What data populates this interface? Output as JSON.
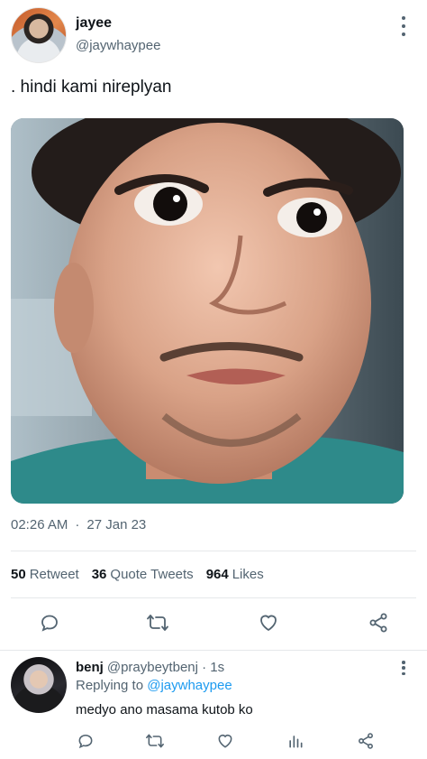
{
  "tweet": {
    "display_name": "jayee",
    "handle": "@jaywhaypee",
    "text": ". hindi kami nireplyan",
    "time": "02:26 AM",
    "separator": "·",
    "date": "27 Jan 23",
    "stats": {
      "retweets_count": "50",
      "retweets_label": "Retweet",
      "quotes_count": "36",
      "quotes_label": "Quote Tweets",
      "likes_count": "964",
      "likes_label": "Likes"
    }
  },
  "reply": {
    "display_name": "benj",
    "handle_time": "@praybeytbenj · 1s",
    "replying_prefix": "Replying to",
    "replying_to": "@jaywhaypee",
    "text": "medyo ano masama kutob ko"
  },
  "icons": {
    "reply": "reply-icon",
    "retweet": "retweet-icon",
    "like": "heart-icon",
    "share": "share-icon",
    "views": "analytics-icon",
    "more": "more-vertical-icon"
  },
  "colors": {
    "text_primary": "#0f1419",
    "text_secondary": "#536471",
    "link": "#1d9bf0",
    "divider": "#e6e8ea"
  }
}
